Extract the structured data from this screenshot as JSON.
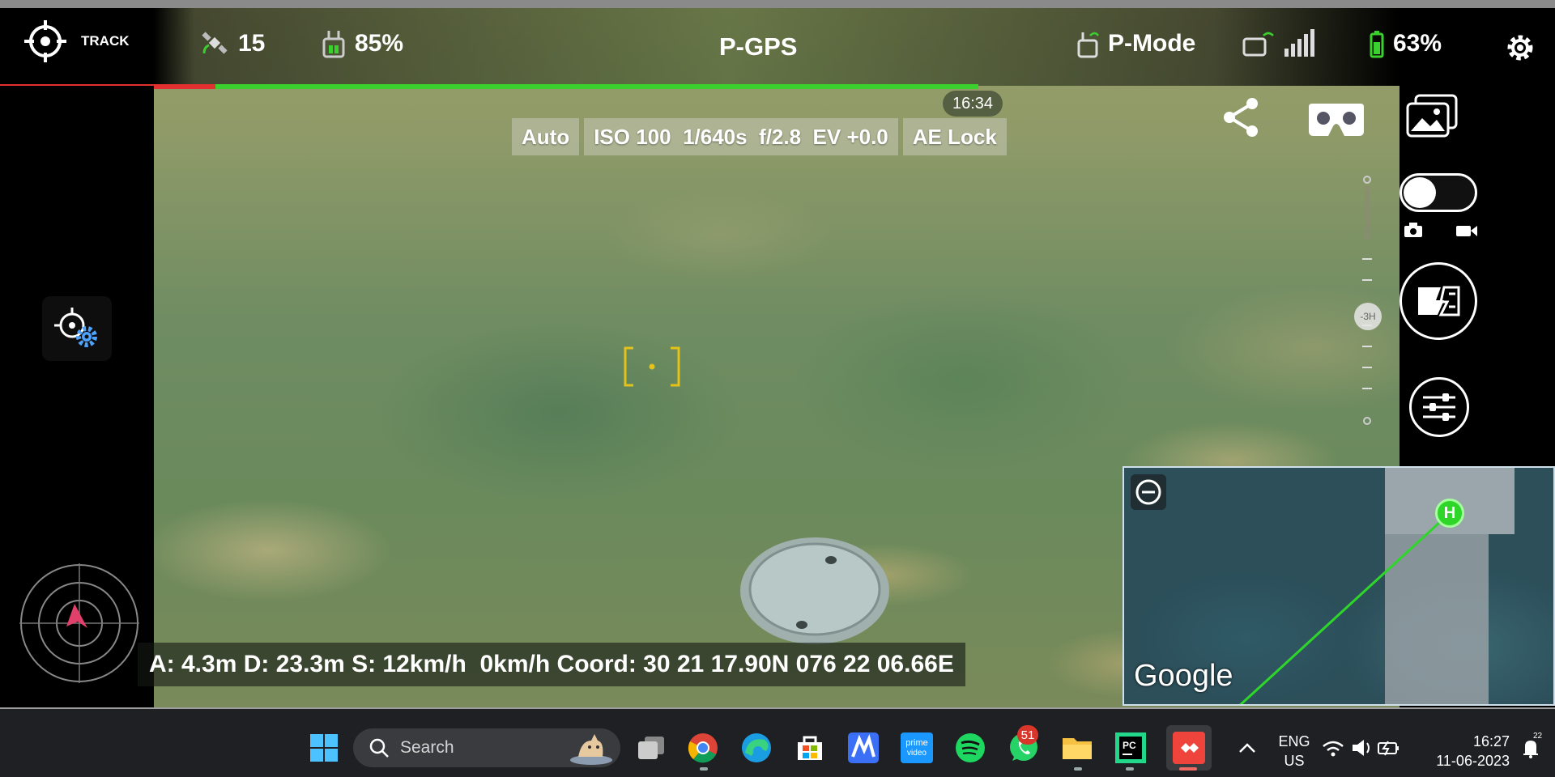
{
  "top_bar": {
    "track_label": "TRACK",
    "satellite_count": "15",
    "rc_battery": "85%",
    "flight_mode": "P-GPS",
    "remote_mode": "P-Mode",
    "drone_battery": "63%"
  },
  "flight_progress": {
    "red_fraction": 0.22,
    "green_fraction": 0.78
  },
  "camera": {
    "time": "16:34",
    "exposure": [
      "Auto",
      "ISO 100",
      "1/640s",
      "f/2.8",
      "EV +0.0",
      "AE Lock"
    ],
    "zoom_level": "-3H"
  },
  "telemetry": "A: 4.3m D: 23.3m S: 12km/h  0km/h Coord: 30 21 17.90N 076 22 06.66E",
  "map": {
    "home_label": "H",
    "provider": "Google"
  },
  "taskbar": {
    "search_placeholder": "Search",
    "whatsapp_badge": "51",
    "lang_line1": "ENG",
    "lang_line2": "US",
    "time": "16:27",
    "date": "11-06-2023",
    "notification_count": "22"
  },
  "icons": [
    "crosshair-track-icon",
    "satellite-icon",
    "remote-controller-icon",
    "settings-gear-icon",
    "share-icon",
    "vr-goggles-icon",
    "gallery-icon",
    "camera-icon",
    "video-icon",
    "shutter-icon",
    "sliders-icon",
    "zoom-out-icon",
    "home-marker-icon",
    "radar-icon"
  ],
  "colors": {
    "progress_red": "#e23030",
    "progress_green": "#3ad12e",
    "focus_box": "#e3c21a",
    "home_marker": "#2fd62a"
  }
}
